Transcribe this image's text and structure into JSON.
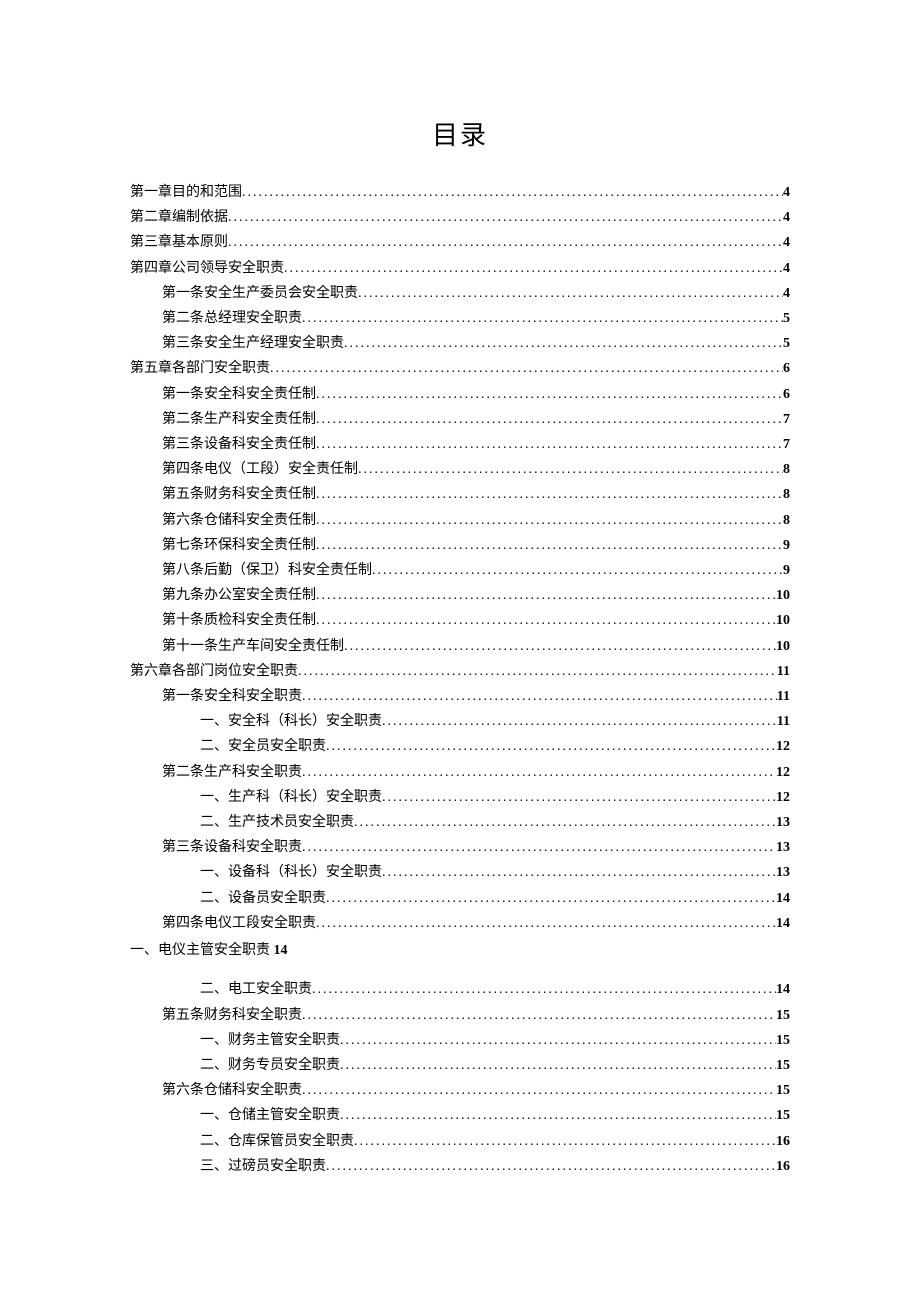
{
  "title": "目录",
  "standalone_row": {
    "text": "一、电仪主管安全职责",
    "page": "14"
  },
  "entries": [
    {
      "level": 0,
      "label": "第一章目的和范围",
      "page": "4"
    },
    {
      "level": 0,
      "label": "第二章编制依据",
      "page": "4"
    },
    {
      "level": 0,
      "label": "第三章基本原则",
      "page": "4"
    },
    {
      "level": 0,
      "label": "第四章公司领导安全职责",
      "page": "4"
    },
    {
      "level": 1,
      "label": "第一条安全生产委员会安全职责",
      "page": "4"
    },
    {
      "level": 1,
      "label": "第二条总经理安全职责",
      "page": "5"
    },
    {
      "level": 1,
      "label": "第三条安全生产经理安全职责",
      "page": "5"
    },
    {
      "level": 0,
      "label": "第五章各部门安全职责",
      "page": "6"
    },
    {
      "level": 1,
      "label": "第一条安全科安全责任制",
      "page": "6"
    },
    {
      "level": 1,
      "label": "第二条生产科安全责任制",
      "page": "7"
    },
    {
      "level": 1,
      "label": "第三条设备科安全责任制",
      "page": "7"
    },
    {
      "level": 1,
      "label": "第四条电仪（工段）安全责任制",
      "page": "8"
    },
    {
      "level": 1,
      "label": "第五条财务科安全责任制",
      "page": "8"
    },
    {
      "level": 1,
      "label": "第六条仓储科安全责任制",
      "page": "8"
    },
    {
      "level": 1,
      "label": "第七条环保科安全责任制",
      "page": "9"
    },
    {
      "level": 1,
      "label": "第八条后勤（保卫）科安全责任制",
      "page": "9"
    },
    {
      "level": 1,
      "label": "第九条办公室安全责任制",
      "page": "10"
    },
    {
      "level": 1,
      "label": "第十条质检科安全责任制",
      "page": "10"
    },
    {
      "level": 1,
      "label": "第十一条生产车间安全责任制",
      "page": "10"
    },
    {
      "level": 0,
      "label": "第六章各部门岗位安全职责",
      "page": "11"
    },
    {
      "level": 1,
      "label": "第一条安全科安全职责",
      "page": "11"
    },
    {
      "level": 2,
      "label": "一、安全科（科长）安全职责",
      "page": "11"
    },
    {
      "level": 2,
      "label": "二、安全员安全职责",
      "page": "12"
    },
    {
      "level": 1,
      "label": "第二条生产科安全职责",
      "page": "12"
    },
    {
      "level": 2,
      "label": "一、生产科（科长）安全职责",
      "page": "12"
    },
    {
      "level": 2,
      "label": "二、生产技术员安全职责",
      "page": "13"
    },
    {
      "level": 1,
      "label": "第三条设备科安全职责",
      "page": "13"
    },
    {
      "level": 2,
      "label": "一、设备科（科长）安全职责",
      "page": "13"
    },
    {
      "level": 2,
      "label": "二、设备员安全职责",
      "page": "14"
    },
    {
      "level": 1,
      "label": "第四条电仪工段安全职责",
      "page": "14"
    },
    {
      "level": -1,
      "label": "STANDALONE",
      "page": ""
    },
    {
      "level": 2,
      "label": "二、电工安全职责",
      "page": "14"
    },
    {
      "level": 1,
      "label": "第五条财务科安全职责",
      "page": "15"
    },
    {
      "level": 2,
      "label": "一、财务主管安全职责",
      "page": "15"
    },
    {
      "level": 2,
      "label": "二、财务专员安全职责",
      "page": "15"
    },
    {
      "level": 1,
      "label": "第六条仓储科安全职责",
      "page": "15"
    },
    {
      "level": 2,
      "label": "一、仓储主管安全职责",
      "page": "15"
    },
    {
      "level": 2,
      "label": "二、仓库保管员安全职责",
      "page": "16"
    },
    {
      "level": 2,
      "label": "三、过磅员安全职责",
      "page": "16"
    }
  ]
}
